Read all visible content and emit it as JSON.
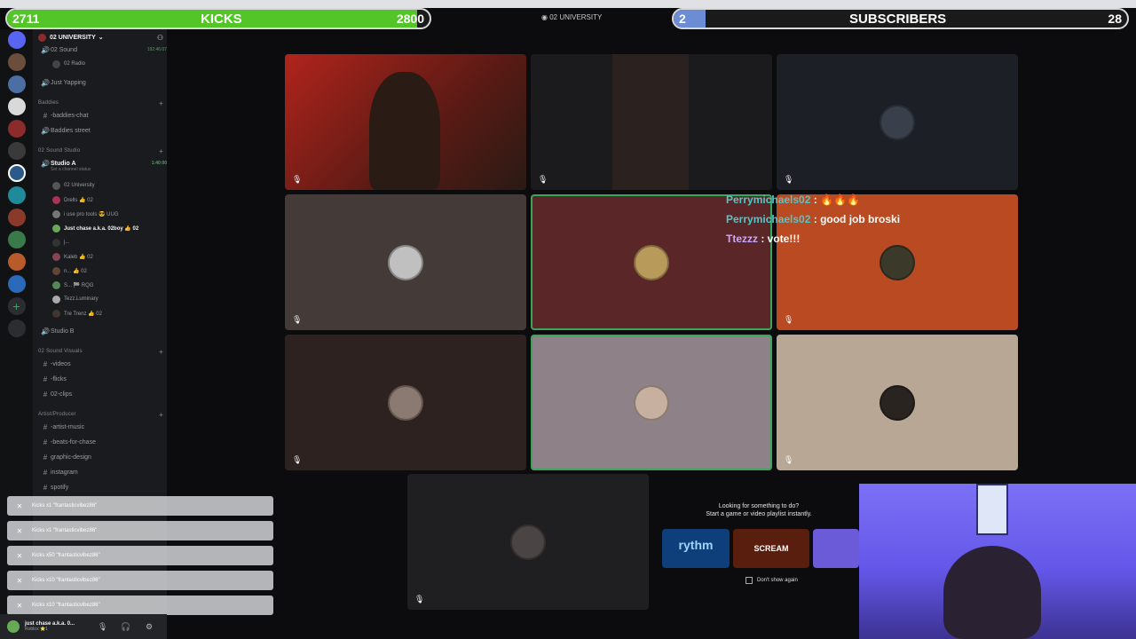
{
  "overlay": {
    "kicks": {
      "current": "2711",
      "label": "KICKS",
      "goal": "2800",
      "progress": 0.97
    },
    "subs": {
      "current": "2",
      "label": "SUBSCRIBERS",
      "goal": "28",
      "progress": 0.07
    },
    "colors": {
      "kicks_fill": "#53c528",
      "subs_fill": "#6d8cd6"
    }
  },
  "server": {
    "name": "02 UNIVERSITY",
    "title_top": "02 UNIVERSITY"
  },
  "sidebar": {
    "channels_top": [
      {
        "label": "02 Sound",
        "timer": "192:46:07"
      },
      {
        "label": "02 Radio"
      },
      {
        "label": "Just Yapping"
      }
    ],
    "cat_baddies": "Baddies",
    "baddies": [
      "-baddies-chat",
      "Baddies street"
    ],
    "cat_sound_studio": "02 Sound Studio",
    "studio_a": {
      "label": "Studio A",
      "status": "Set a channel status",
      "timer": "1:40:00"
    },
    "studio_users": [
      "02 University",
      "Drells 👍 02",
      "i use pro tools 😎 UUG",
      "Just chase a.k.a. 02boy 👍 02",
      "j...",
      "Kaleb 👍 02",
      "n... 👍 02",
      "S... 🏁 RQG",
      "Tezz.Luminary",
      "Tre Trenz 👍 02"
    ],
    "studio_b": "Studio B",
    "cat_visuals": "02 Sound Visuals",
    "visuals": [
      "-videos",
      "-flicks",
      "02-clips"
    ],
    "cat_artist": "Artist/Producer",
    "artist": [
      "-artist-music",
      "-beats-for-chase",
      "graphic-design",
      "instagram",
      "spotify"
    ]
  },
  "notifications": [
    "Kicks x1 \"frantasticvibez86\"",
    "Kicks x1 \"frantasticvibez86\"",
    "Kicks x50 \"frantasticvibez86\"",
    "Kicks x10 \"frantasticvibez86\"",
    "Kicks x10 \"frantasticvibez86\""
  ],
  "chat": [
    {
      "name": "Perrymichaels02",
      "text": " : 🔥🔥🔥"
    },
    {
      "name": "Perrymichaels02",
      "text": " : good job broski"
    },
    {
      "name": "Ttezzz",
      "text": " : vote!!!"
    }
  ],
  "promo": {
    "line1": "Looking for something to do?",
    "line2": "Start a game or video playlist instantly.",
    "dont_show": "Don't show again",
    "card1": "rythm",
    "card2": "SCREAM"
  },
  "user_panel": {
    "name": "just chase a.k.a. 0...",
    "sub": "Roblox ⭐1"
  },
  "icons": {
    "mic_off": "🎙",
    "speaker": "🔊",
    "hash": "#",
    "plus": "+",
    "close": "✕"
  }
}
